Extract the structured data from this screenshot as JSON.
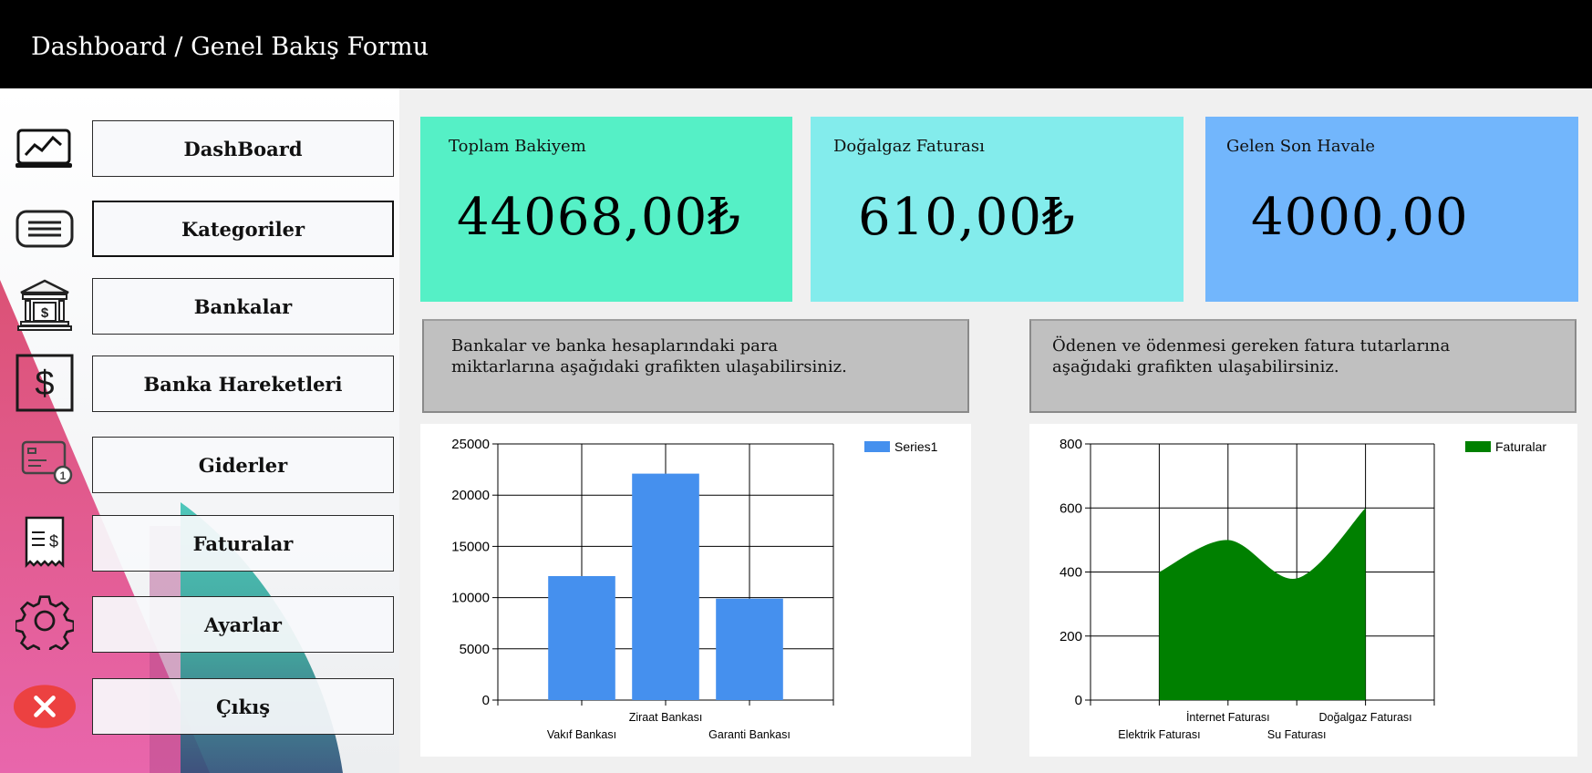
{
  "window": {
    "title": "Dashboard / Genel Bakış Formu"
  },
  "sidebar": {
    "items": [
      {
        "label": "DashBoard",
        "icon": "chart-line-icon"
      },
      {
        "label": "Kategoriler",
        "icon": "list-icon"
      },
      {
        "label": "Bankalar",
        "icon": "bank-icon"
      },
      {
        "label": "Banka Hareketleri",
        "icon": "dollar-icon"
      },
      {
        "label": "Giderler",
        "icon": "card-icon"
      },
      {
        "label": "Faturalar",
        "icon": "receipt-icon"
      },
      {
        "label": "Ayarlar",
        "icon": "gear-icon"
      },
      {
        "label": "Çıkış",
        "icon": "close-icon"
      }
    ]
  },
  "cards": [
    {
      "label": "Toplam Bakiyem",
      "value": "44068,00₺",
      "color": "#55f0c6"
    },
    {
      "label": "Doğalgaz Faturası",
      "value": "610,00₺",
      "color": "#83ecec"
    },
    {
      "label": "Gelen Son Havale",
      "value": "4000,00",
      "color": "#72b6fc"
    }
  ],
  "info": {
    "left": "Bankalar ve banka hesaplarındaki para miktarlarına aşağıdaki grafikten ulaşabilirsiniz.",
    "right": "Ödenen ve ödenmesi gereken fatura tutarlarına aşağıdaki grafikten ulaşabilirsiniz."
  },
  "chart_data": [
    {
      "type": "bar",
      "categories": [
        "Vakıf Bankası",
        "Ziraat Bankası",
        "Garanti Bankası"
      ],
      "series": [
        {
          "name": "Series1",
          "values": [
            12100,
            22100,
            9900
          ],
          "color": "#4590ee"
        }
      ],
      "ylim": [
        0,
        25000
      ],
      "yticks": [
        0,
        5000,
        10000,
        15000,
        20000,
        25000
      ],
      "legend": "top-right",
      "grid": true
    },
    {
      "type": "area",
      "categories": [
        "Elektrik Faturası",
        "İnternet Faturası",
        "Su Faturası",
        "Doğalgaz Faturası"
      ],
      "series": [
        {
          "name": "Faturalar",
          "values": [
            400,
            500,
            380,
            600
          ],
          "color": "#008000"
        }
      ],
      "ylim": [
        0,
        800
      ],
      "yticks": [
        0,
        200,
        400,
        600,
        800
      ],
      "legend": "top-right",
      "grid": true
    }
  ]
}
